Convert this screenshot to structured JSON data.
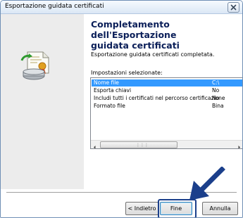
{
  "window": {
    "title": "Esportazione guidata certificati"
  },
  "main": {
    "heading_line1": "Completamento dell'Esportazione",
    "heading_line2": "guidata certificati",
    "completed_text": "Esportazione guidata certificati completata.",
    "settings_label": "Impostazioni selezionate:",
    "settings": [
      {
        "name": "Nome file",
        "value": "C:\\",
        "selected": true
      },
      {
        "name": "Esporta chiavi",
        "value": "No"
      },
      {
        "name": "Includi tutti i certificati nel percorso certificazione",
        "value": "No"
      },
      {
        "name": "Formato file",
        "value": "Bina"
      }
    ]
  },
  "buttons": {
    "back": "< Indietro",
    "finish": "Fine",
    "cancel": "Annulla"
  },
  "icons": {
    "close": "close-icon",
    "wizard": "certificate-export-icon",
    "arrow": "pointer-arrow-icon"
  },
  "colors": {
    "heading": "#0b1f59",
    "selection": "#3399ff",
    "annotation": "#1b3f8b"
  }
}
